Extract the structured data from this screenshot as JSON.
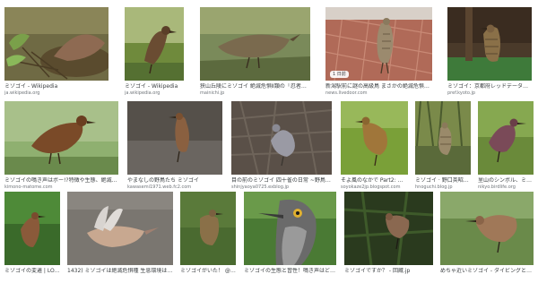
{
  "results": [
    {
      "caption": "ミゾゴイ - Wikipedia",
      "source": "ja.wikipedia.org"
    },
    {
      "caption": "ミゾゴイ - Wikipedia",
      "source": "ja.wikipedia.org"
    },
    {
      "caption": "狭山丘陵にミゾゴイ 絶滅危惧Ⅱ類の「忍者鳥」 元本...",
      "source": "mainichi.jp"
    },
    {
      "caption": "新潟駅前に謎の高級鳥 まさかの絶滅危惧種「ミゾ...",
      "source": "news.livedoor.com",
      "age": "1 日前"
    },
    {
      "caption": "ミゾゴイ：京都府レッドデータブック2...",
      "source": "pref.kyoto.jp"
    },
    {
      "caption": "ミゾゴイの鳴き声はボー!?特徴や生態、絶滅危惧...",
      "source": "kimono-matome.com"
    },
    {
      "caption": "やまなしの野鳥たち ミゾゴイ",
      "source": "kawasemi1971.web.fc2.com"
    },
    {
      "caption": "目の前のミゾゴイ 四十雀の日常 ~野鳥写真...",
      "source": "shinjyaoya0725.exblog.jp"
    },
    {
      "caption": "そよ風のなかで Part2: ミゾ...",
      "source": "soyokaze2jp.blogspot.com"
    },
    {
      "caption": "ミゾゴイ · 野口英昭の...",
      "source": "hnoguchi.blog.jp"
    },
    {
      "caption": "里山のシンボル、ミゾゴイ...",
      "source": "nikyo.birdlife.org"
    },
    {
      "caption": "ミゾゴイの変遷 | LOVE...",
      "source": ""
    },
    {
      "caption": "1432) ミゾゴイは絶滅危惧種 生息環境は世界で...",
      "source": ""
    },
    {
      "caption": "ミゾゴイがいた！ @眼...",
      "source": ""
    },
    {
      "caption": "ミゾゴイの生態と習性！鳴き声はどんな...",
      "source": ""
    },
    {
      "caption": "ミゾゴイですか？ - 回蔵.jp",
      "source": ""
    },
    {
      "caption": "めちゃ近いミゾゴイ - ダイビングと生き...",
      "source": ""
    }
  ]
}
